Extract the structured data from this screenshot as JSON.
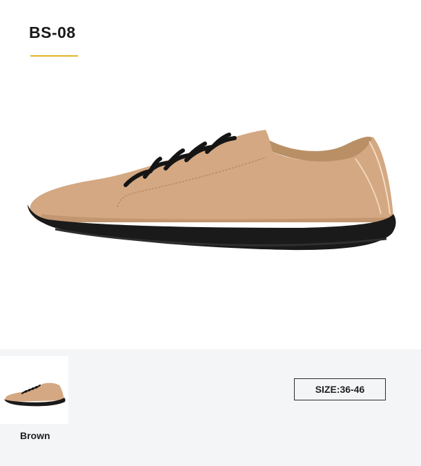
{
  "product": {
    "model": "BS-08",
    "accent_color": "#e3b422",
    "main_image_icon": "shoe-side-view"
  },
  "variants": [
    {
      "label": "Brown",
      "color": "#d4a882",
      "sole_color": "#1a1a1a"
    }
  ],
  "size": {
    "label": "SIZE:36-46"
  }
}
